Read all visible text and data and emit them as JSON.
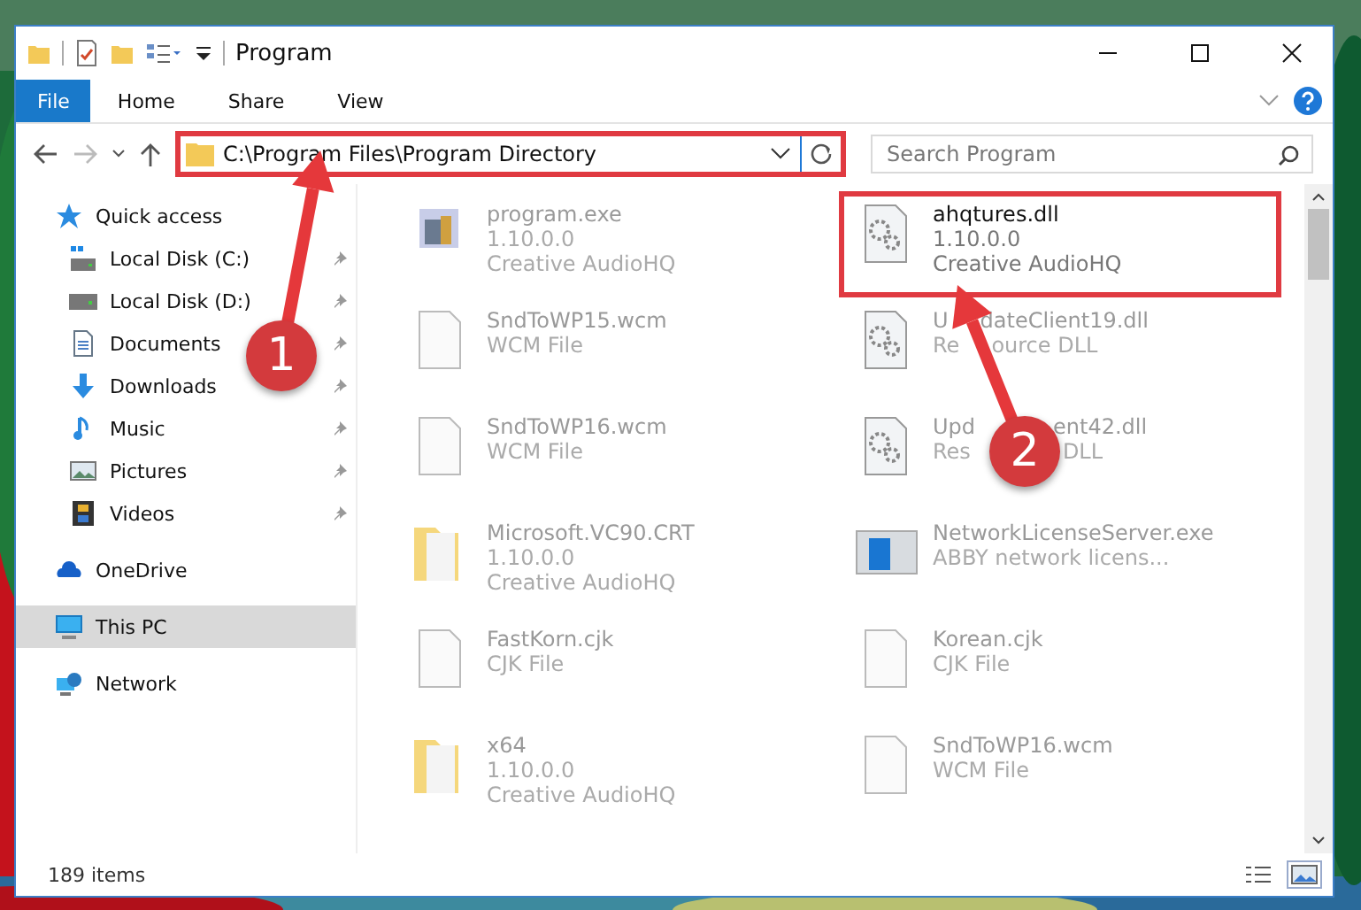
{
  "window": {
    "title": "Program"
  },
  "ribbon_tabs": [
    {
      "label": "File",
      "kind": "file",
      "selected": false
    },
    {
      "label": "Home",
      "kind": "tab",
      "selected": false
    },
    {
      "label": "Share",
      "kind": "tab",
      "selected": false
    },
    {
      "label": "View",
      "kind": "tab",
      "selected": false
    }
  ],
  "address": {
    "value": "C:\\Program Files\\Program Directory",
    "highlighted": true
  },
  "search": {
    "placeholder": "Search Program"
  },
  "sidebar": {
    "items": [
      {
        "label": "Quick access",
        "selected": false,
        "children": [
          {
            "label": "Local Disk (C:)",
            "pinned": true
          },
          {
            "label": "Local Disk (D:)",
            "pinned": true
          },
          {
            "label": "Documents",
            "pinned": true
          },
          {
            "label": "Downloads",
            "pinned": true
          },
          {
            "label": "Music",
            "pinned": true
          },
          {
            "label": "Pictures",
            "pinned": true
          },
          {
            "label": "Videos",
            "pinned": true
          }
        ]
      },
      {
        "label": "OneDrive",
        "selected": false
      },
      {
        "label": "This PC",
        "selected": true
      },
      {
        "label": "Network",
        "selected": false
      }
    ]
  },
  "files": [
    {
      "name": [
        "program.exe"
      ],
      "lines": [
        [
          "1.10.0.0"
        ],
        [
          "Creative AudioHQ"
        ]
      ],
      "kind": "exe",
      "dimmed": true,
      "highlighted": false
    },
    {
      "name": [
        "ahqtures.dll"
      ],
      "lines": [
        [
          "1.10.0.0"
        ],
        [
          "Creative AudioHQ"
        ]
      ],
      "kind": "dll",
      "dimmed": false,
      "highlighted": true
    },
    {
      "name": [
        "SndToWP15.wcm"
      ],
      "lines": [
        [
          "WCM File"
        ]
      ],
      "kind": "doc",
      "dimmed": true,
      "highlighted": false
    },
    {
      "name": [
        "U",
        "dateClient19.dll"
      ],
      "lines": [
        [
          "Re",
          "ource DLL"
        ]
      ],
      "kind": "dll",
      "dimmed": true,
      "highlighted": false
    },
    {
      "name": [
        "SndToWP16.wcm"
      ],
      "lines": [
        [
          "WCM File"
        ]
      ],
      "kind": "doc",
      "dimmed": true,
      "highlighted": false
    },
    {
      "name": [
        "Upd",
        "ent42.dll"
      ],
      "lines": [
        [
          "Res",
          "DLL"
        ]
      ],
      "kind": "dll",
      "dimmed": true,
      "highlighted": false
    },
    {
      "name": [
        "Microsoft.VC90.CRT"
      ],
      "lines": [
        [
          "1.10.0.0"
        ],
        [
          "Creative AudioHQ"
        ]
      ],
      "kind": "folder",
      "dimmed": true,
      "highlighted": false
    },
    {
      "name": [
        "NetworkLicenseServer.exe"
      ],
      "lines": [
        [
          "ABBY network licens..."
        ]
      ],
      "kind": "app",
      "dimmed": true,
      "highlighted": false
    },
    {
      "name": [
        "FastKorn.cjk"
      ],
      "lines": [
        [
          "CJK File"
        ]
      ],
      "kind": "doc",
      "dimmed": true,
      "highlighted": false
    },
    {
      "name": [
        "Korean.cjk"
      ],
      "lines": [
        [
          "CJK File"
        ]
      ],
      "kind": "doc",
      "dimmed": true,
      "highlighted": false
    },
    {
      "name": [
        "x64"
      ],
      "lines": [
        [
          "1.10.0.0"
        ],
        [
          "Creative AudioHQ"
        ]
      ],
      "kind": "folder",
      "dimmed": true,
      "highlighted": false
    },
    {
      "name": [
        "SndToWP16.wcm"
      ],
      "lines": [
        [
          "WCM File"
        ]
      ],
      "kind": "doc",
      "dimmed": true,
      "highlighted": false
    }
  ],
  "status_bar": {
    "count": "189 items",
    "views": [
      {
        "kind": "details",
        "selected": false
      },
      {
        "kind": "tiles",
        "selected": true
      }
    ]
  },
  "annotations": [
    {
      "label": "1"
    },
    {
      "label": "2"
    }
  ]
}
